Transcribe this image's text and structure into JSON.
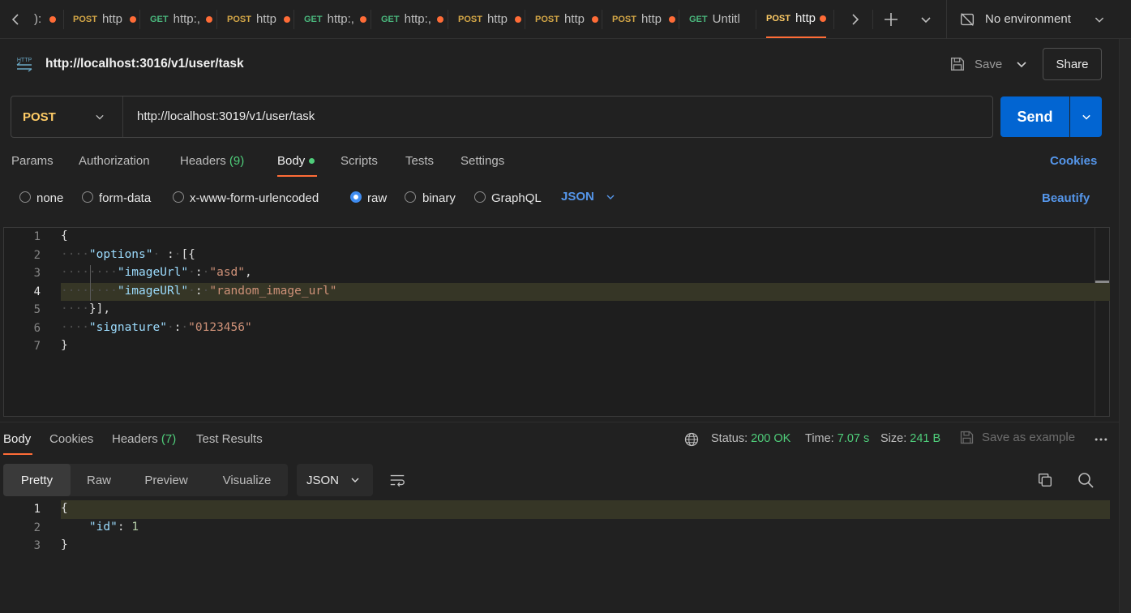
{
  "tabs": [
    {
      "method": "",
      "title": "):",
      "truncated": true
    },
    {
      "method": "POST",
      "title": "http"
    },
    {
      "method": "GET",
      "title": "http:,"
    },
    {
      "method": "POST",
      "title": "http"
    },
    {
      "method": "GET",
      "title": "http:,"
    },
    {
      "method": "GET",
      "title": "http:,"
    },
    {
      "method": "POST",
      "title": "http"
    },
    {
      "method": "POST",
      "title": "http"
    },
    {
      "method": "POST",
      "title": "http"
    },
    {
      "method": "GET",
      "title": "Untitl"
    },
    {
      "method": "POST",
      "title": "http",
      "active": true
    }
  ],
  "environment": {
    "label": "No environment"
  },
  "request": {
    "name": "http://localhost:3016/v1/user/task",
    "method": "POST",
    "url": "http://localhost:3019/v1/user/task",
    "save_label": "Save",
    "share_label": "Share",
    "send_label": "Send"
  },
  "request_tabs": {
    "params": "Params",
    "authorization": "Authorization",
    "headers": "Headers",
    "headers_count": "(9)",
    "body": "Body",
    "scripts": "Scripts",
    "tests": "Tests",
    "settings": "Settings",
    "cookies": "Cookies"
  },
  "body_types": {
    "none": "none",
    "form_data": "form-data",
    "urlencoded": "x-www-form-urlencoded",
    "raw": "raw",
    "binary": "binary",
    "graphql": "GraphQL",
    "format": "JSON",
    "beautify": "Beautify",
    "selected": "raw"
  },
  "request_body": {
    "line_numbers": [
      "1",
      "2",
      "3",
      "4",
      "5",
      "6",
      "7"
    ],
    "lines": [
      "{",
      "\"options\" : [{",
      "\"imageUrl\" : \"asd\",",
      "\"imageURl\" : \"random_image_url\"",
      "}],",
      "\"signature\" : \"0123456\"",
      "}"
    ],
    "t": {
      "brace_open": "{",
      "k_options": "\"options\"",
      "colon": ":",
      "arr_open": "[{",
      "k_imageUrl": "\"imageUrl\"",
      "v_asd": "\"asd\"",
      "comma": ",",
      "k_imageURl": "\"imageURl\"",
      "v_random": "\"random_image_url\"",
      "arr_close": "}],",
      "k_signature": "\"signature\"",
      "v_signature": "\"0123456\"",
      "brace_close": "}"
    }
  },
  "response": {
    "tabs": {
      "body": "Body",
      "cookies": "Cookies",
      "headers": "Headers",
      "headers_count": "(7)",
      "test_results": "Test Results"
    },
    "status_label": "Status:",
    "status_value": "200 OK",
    "time_label": "Time:",
    "time_value": "7.07 s",
    "size_label": "Size:",
    "size_value": "241 B",
    "save_example": "Save as example",
    "view_modes": {
      "pretty": "Pretty",
      "raw": "Raw",
      "preview": "Preview",
      "visualize": "Visualize"
    },
    "format": "JSON",
    "line_numbers": [
      "1",
      "2",
      "3"
    ],
    "lines": [
      "{",
      "\"id\": 1",
      "}"
    ],
    "t": {
      "brace_open": "{",
      "k_id": "\"id\"",
      "colon": ":",
      "v_id": "1",
      "brace_close": "}"
    }
  },
  "colors": {
    "background": "#212121",
    "accent_orange": "#ff6c37",
    "send_blue": "#0265d2",
    "link_blue": "#5596ea",
    "status_green": "#4fcd7a",
    "post_yellow": "#ffcc66",
    "get_green": "#4ab77d"
  }
}
